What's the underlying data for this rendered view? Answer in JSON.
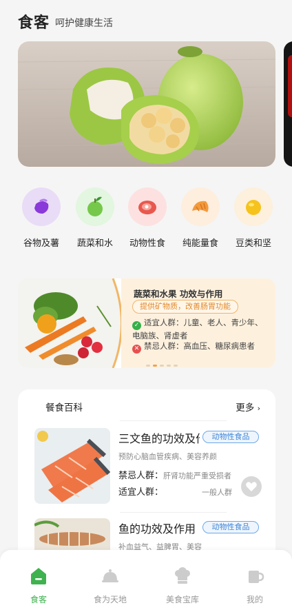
{
  "header": {
    "logo": "食客",
    "slogan": "呵护健康生活"
  },
  "categories": [
    {
      "label": "谷物及薯",
      "color": "#e9dcf7"
    },
    {
      "label": "蔬菜和水",
      "color": "#e2f6e0"
    },
    {
      "label": "动物性食",
      "color": "#fde1e1"
    },
    {
      "label": "纯能量食",
      "color": "#fdeede"
    },
    {
      "label": "豆类和坚",
      "color": "#fdf0dc"
    }
  ],
  "promo": {
    "title": "蔬菜和水果 功效与作用",
    "tag": "提供矿物质，改善肠胃功能",
    "suitable": "适宜人群：儿童、老人、青少年、电脑族、肾虚者",
    "taboo": "禁忌人群：高血压、糖尿病患者"
  },
  "encyclopedia": {
    "title": "餐食百科",
    "more": "更多",
    "items": [
      {
        "title": "三文鱼的功效及作用",
        "badge": "动物性食品",
        "subtitle": "预防心脑血管疾病、美容养颜",
        "taboo_label": "禁忌人群：",
        "taboo_value": "肝肾功能严重受损者",
        "suitable_label": "适宜人群：",
        "suitable_value": "一般人群"
      },
      {
        "title": "鱼的功效及作用",
        "badge": "动物性食品",
        "subtitle": "补血益气、益脾胃、美容"
      }
    ]
  },
  "tabbar": {
    "tabs": [
      {
        "label": "食客",
        "active": true
      },
      {
        "label": "食为天地",
        "active": false
      },
      {
        "label": "美食宝库",
        "active": false
      },
      {
        "label": "我的",
        "active": false
      }
    ],
    "active_color": "#3fb24f"
  }
}
